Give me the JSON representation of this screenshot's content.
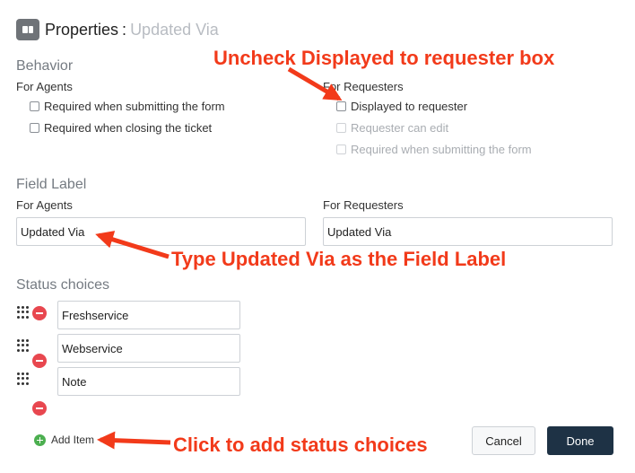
{
  "header": {
    "title": "Properties",
    "separator": ":",
    "subtitle": "Updated Via",
    "icon": "field-properties-icon"
  },
  "behavior": {
    "heading": "Behavior",
    "agents": {
      "label": "For Agents",
      "options": [
        {
          "label": "Required when submitting the form",
          "checked": false
        },
        {
          "label": "Required when closing the ticket",
          "checked": false
        }
      ]
    },
    "requesters": {
      "label": "For Requesters",
      "options": [
        {
          "label": "Displayed to requester",
          "checked": false,
          "disabled": false
        },
        {
          "label": "Requester can edit",
          "checked": false,
          "disabled": true
        },
        {
          "label": "Required when submitting the form",
          "checked": false,
          "disabled": true
        }
      ]
    }
  },
  "field_label": {
    "heading": "Field Label",
    "agents": {
      "label": "For Agents",
      "value": "Updated Via"
    },
    "requesters": {
      "label": "For Requesters",
      "value": "Updated Via"
    }
  },
  "status_choices": {
    "heading": "Status choices",
    "items": [
      {
        "value": "Freshservice"
      },
      {
        "value": "Webservice"
      },
      {
        "value": "Note"
      }
    ]
  },
  "footer": {
    "add_item_label": "Add Item",
    "cancel_label": "Cancel",
    "done_label": "Done"
  },
  "annotations": {
    "uncheck": "Uncheck Displayed to requester box",
    "type_label": "Type Updated Via as the Field Label",
    "add_status": "Click to add status choices",
    "color": "#f23a1a"
  },
  "colors": {
    "primary_button": "#1e3245",
    "remove_icon": "#e8474f",
    "add_icon": "#4caf50"
  }
}
